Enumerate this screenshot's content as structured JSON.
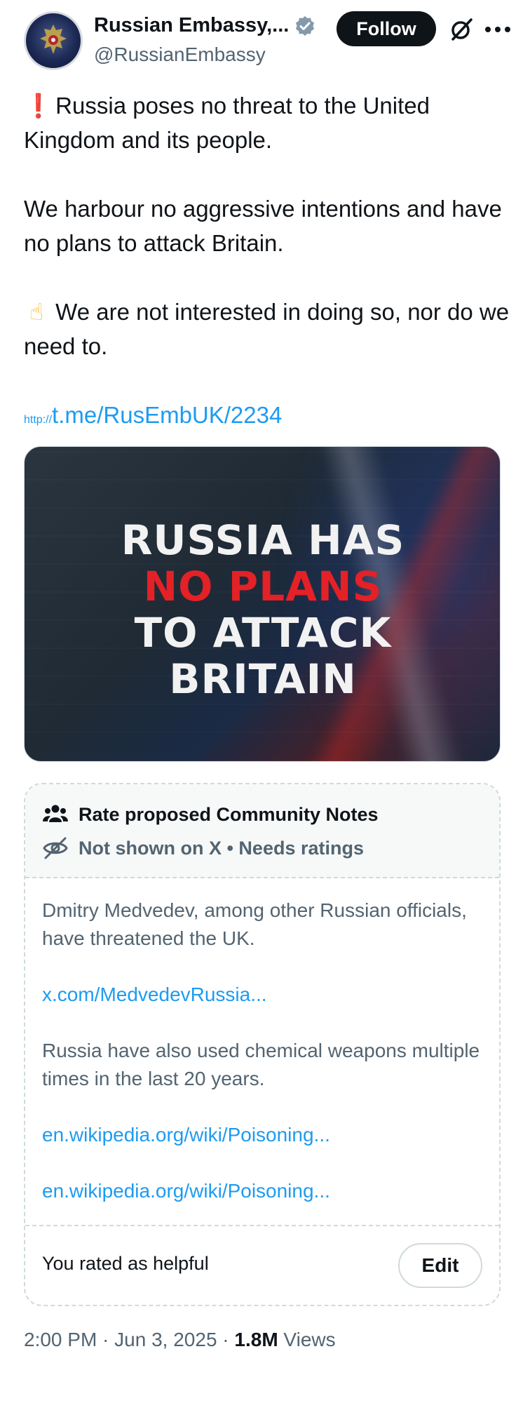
{
  "account": {
    "display_name": "Russian Embassy,...",
    "handle": "@RussianEmbassy",
    "follow_label": "Follow"
  },
  "icons": {
    "verified": "verified-badge-icon",
    "grok": "grok-icon",
    "more": "more-options-icon",
    "people": "people-icon",
    "not_shown": "eye-slash-icon"
  },
  "tweet": {
    "line1_emoji": "❗",
    "line1": "Russia poses no threat to the United Kingdom and its people.",
    "line2": "We harbour no aggressive intentions and have no plans to attack Britain.",
    "line3_emoji": "☝",
    "line3": "We are not interested in doing so, nor do we need to.",
    "link_proto": "http://",
    "link_text": "t.me/RusEmbUK/2234"
  },
  "media": {
    "headline_line1": "RUSSIA HAS",
    "headline_line2": "NO PLANS",
    "headline_line3": "TO ATTACK",
    "headline_line4": "BRITAIN"
  },
  "community_notes": {
    "title": "Rate proposed Community Notes",
    "status": "Not shown on X • Needs ratings",
    "note_text_1": "Dmitry Medvedev, among other Russian officials, have threatened the UK.",
    "note_link_1": "x.com/MedvedevRussia...",
    "note_text_2": "Russia have also used chemical weapons multiple times in the last 20 years.",
    "note_link_2": "en.wikipedia.org/wiki/Poisoning...",
    "note_link_3": "en.wikipedia.org/wiki/Poisoning...",
    "rated_text": "You rated as helpful",
    "edit_label": "Edit"
  },
  "meta": {
    "time": "2:00 PM",
    "sep1": " · ",
    "date": "Jun 3, 2025",
    "sep2": " · ",
    "views_count": "1.8M",
    "views_label": " Views"
  },
  "colors": {
    "accent": "#1d9bf0",
    "text": "#0f1419",
    "muted": "#536471",
    "headline_red": "#e32126"
  }
}
